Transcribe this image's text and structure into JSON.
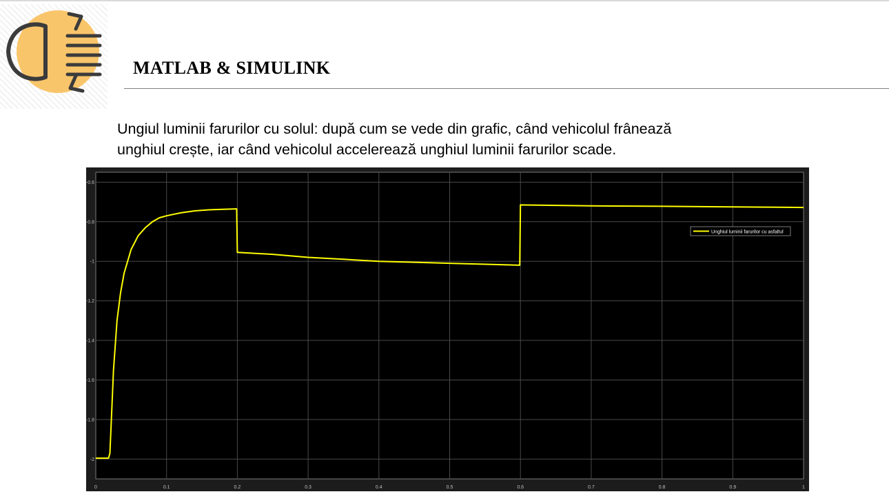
{
  "header": {
    "title": "MATLAB & SIMULINK",
    "logo_icon": "headlight-beam-icon",
    "logo_color": "#f9c56b"
  },
  "description": {
    "line1": "Ungiul luminii farurilor cu solul: după cum se vede din grafic, când vehicolul frânează",
    "line2": "unghiul crește, iar când vehicolul accelerează unghiul luminii farurilor scade."
  },
  "chart_data": {
    "type": "line",
    "title": "",
    "xlabel": "",
    "ylabel": "",
    "xlim": [
      0,
      1
    ],
    "ylim": [
      -2.1,
      -0.55
    ],
    "x_ticks": [
      0,
      0.1,
      0.2,
      0.3,
      0.4,
      0.5,
      0.6,
      0.7,
      0.8,
      0.9,
      1
    ],
    "x_tick_labels": [
      "0",
      "0.1",
      "0.2",
      "0.3",
      "0.4",
      "0.5",
      "0.6",
      "0.7",
      "0.8",
      "0.9",
      "1"
    ],
    "y_ticks": [
      -0.6,
      -0.8,
      -1,
      -1.2,
      -1.4,
      -1.6,
      -1.8,
      -2
    ],
    "y_tick_labels": [
      "-0.6",
      "-0.8",
      "-1",
      "-1.2",
      "-1.4",
      "-1.6",
      "-1.8",
      "-2"
    ],
    "grid": true,
    "legend_position": "top-right",
    "background_color": "#000000",
    "series": [
      {
        "name": "Unghiul luminii farurilor cu asfaltul",
        "color": "#ffff00",
        "x": [
          0,
          0.018,
          0.02,
          0.025,
          0.03,
          0.035,
          0.04,
          0.05,
          0.06,
          0.07,
          0.08,
          0.09,
          0.1,
          0.12,
          0.14,
          0.16,
          0.18,
          0.199,
          0.2,
          0.25,
          0.3,
          0.35,
          0.4,
          0.45,
          0.5,
          0.55,
          0.599,
          0.6,
          0.7,
          0.8,
          0.9,
          1.0
        ],
        "y": [
          -1.995,
          -1.995,
          -1.97,
          -1.55,
          -1.3,
          -1.16,
          -1.06,
          -0.94,
          -0.87,
          -0.83,
          -0.8,
          -0.78,
          -0.77,
          -0.755,
          -0.745,
          -0.74,
          -0.737,
          -0.735,
          -0.955,
          -0.965,
          -0.98,
          -0.99,
          -1.0,
          -1.005,
          -1.01,
          -1.015,
          -1.02,
          -0.715,
          -0.72,
          -0.722,
          -0.725,
          -0.728
        ]
      }
    ]
  }
}
